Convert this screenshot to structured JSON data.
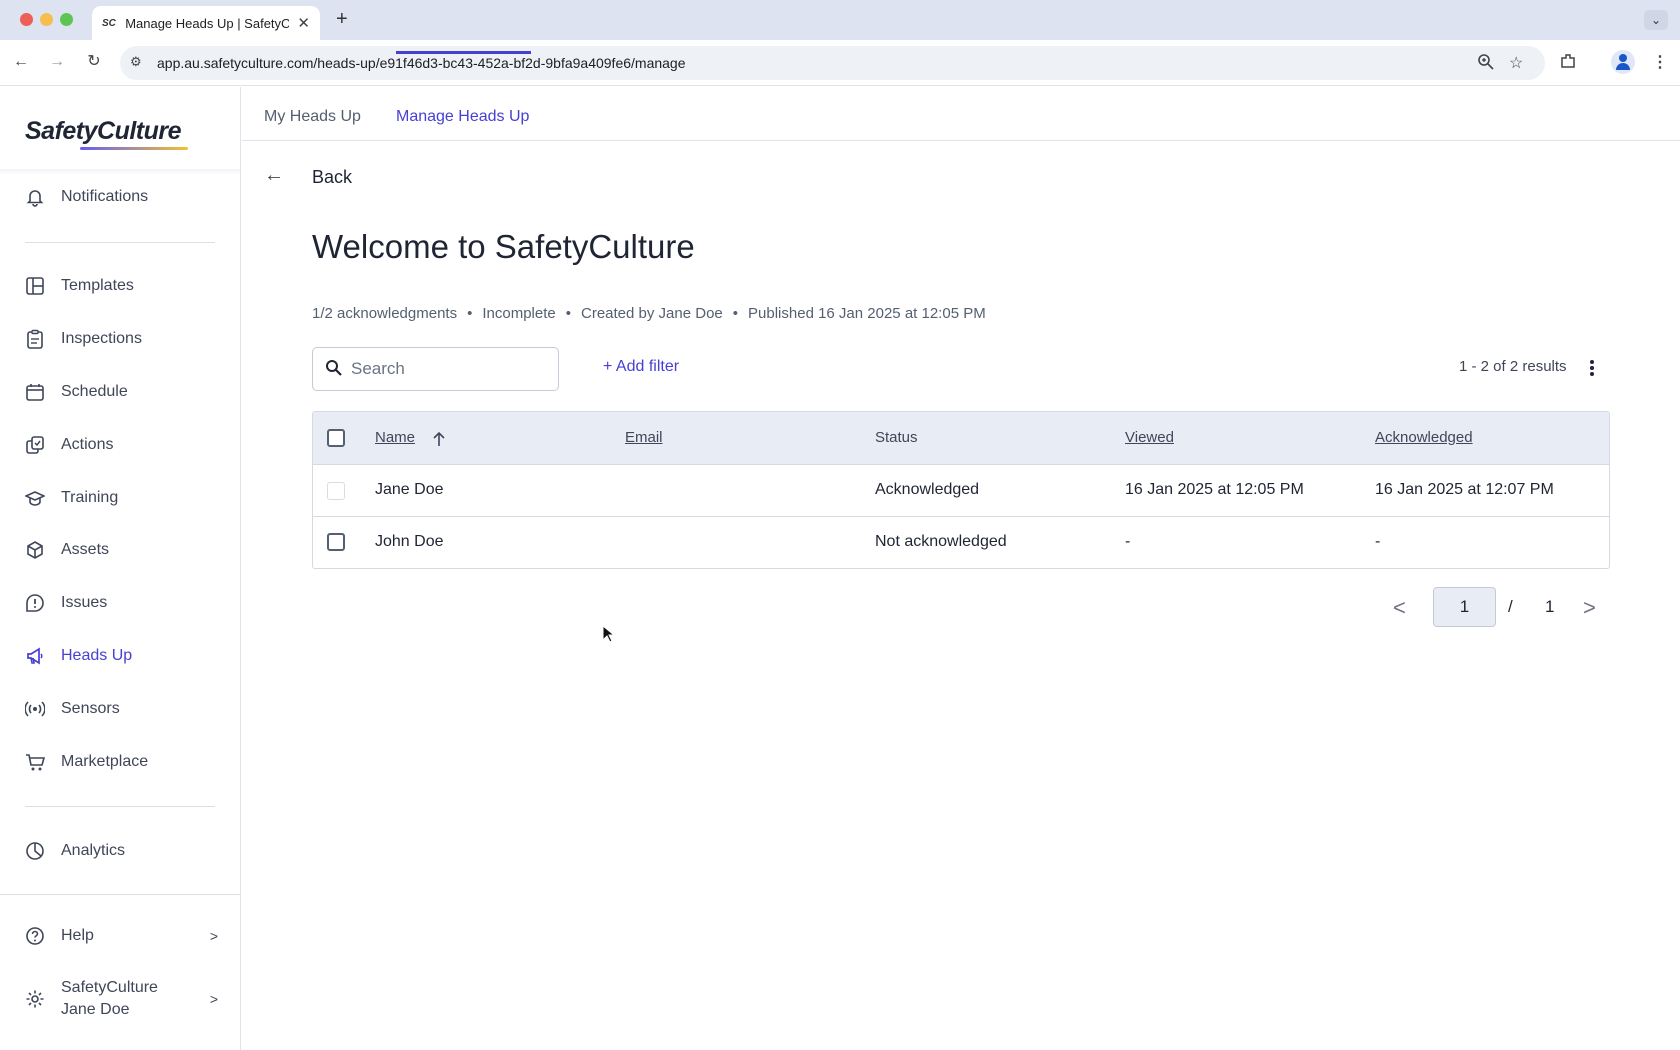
{
  "browser": {
    "tab_title": "Manage Heads Up | SafetyCulture",
    "tab_favicon": "SC",
    "url": "app.au.safetyculture.com/heads-up/e91f46d3-bc43-452a-bf2d-9bfa9a409fe6/manage",
    "icons": [
      "back-icon",
      "forward-icon",
      "reload-icon",
      "site-settings-icon",
      "zoom-icon",
      "bookmark-star-icon",
      "extensions-icon",
      "profile-icon",
      "browser-menu-icon"
    ]
  },
  "sidebar": {
    "logo": "SafetyCulture",
    "items": [
      {
        "label": "Notifications",
        "icon": "bell-icon"
      },
      {
        "label": "Templates",
        "icon": "templates-icon"
      },
      {
        "label": "Inspections",
        "icon": "clipboard-icon"
      },
      {
        "label": "Schedule",
        "icon": "calendar-icon"
      },
      {
        "label": "Actions",
        "icon": "actions-icon"
      },
      {
        "label": "Training",
        "icon": "graduation-cap-icon"
      },
      {
        "label": "Assets",
        "icon": "cube-icon"
      },
      {
        "label": "Issues",
        "icon": "alert-icon"
      },
      {
        "label": "Heads Up",
        "icon": "megaphone-icon",
        "active": true
      },
      {
        "label": "Sensors",
        "icon": "sensor-icon"
      },
      {
        "label": "Marketplace",
        "icon": "cart-icon"
      },
      {
        "label": "Analytics",
        "icon": "pie-chart-icon"
      }
    ],
    "help": "Help",
    "org_line1": "SafetyCulture",
    "org_line2": "Jane Doe"
  },
  "tabs": {
    "my": "My Heads Up",
    "manage": "Manage Heads Up"
  },
  "back_label": "Back",
  "title": "Welcome to SafetyCulture",
  "meta": {
    "acks": "1/2 acknowledgments",
    "status": "Incomplete",
    "created": "Created by Jane Doe",
    "published": "Published 16 Jan 2025 at 12:05 PM"
  },
  "search": {
    "placeholder": "Search",
    "value": ""
  },
  "add_filter": "+ Add filter",
  "results": "1 - 2 of 2 results",
  "table": {
    "headers": {
      "name": "Name",
      "email": "Email",
      "status": "Status",
      "viewed": "Viewed",
      "acknowledged": "Acknowledged"
    },
    "rows": [
      {
        "name": "Jane Doe",
        "email": "",
        "status": "Acknowledged",
        "viewed": "16 Jan 2025 at 12:05 PM",
        "acknowledged": "16 Jan 2025 at 12:07 PM"
      },
      {
        "name": "John Doe",
        "email": "",
        "status": "Not acknowledged",
        "viewed": "-",
        "acknowledged": "-"
      }
    ]
  },
  "pager": {
    "current": "1",
    "separator": "/",
    "total": "1"
  },
  "colors": {
    "accent": "#4740d4",
    "header_bg": "#e8ecf5"
  }
}
